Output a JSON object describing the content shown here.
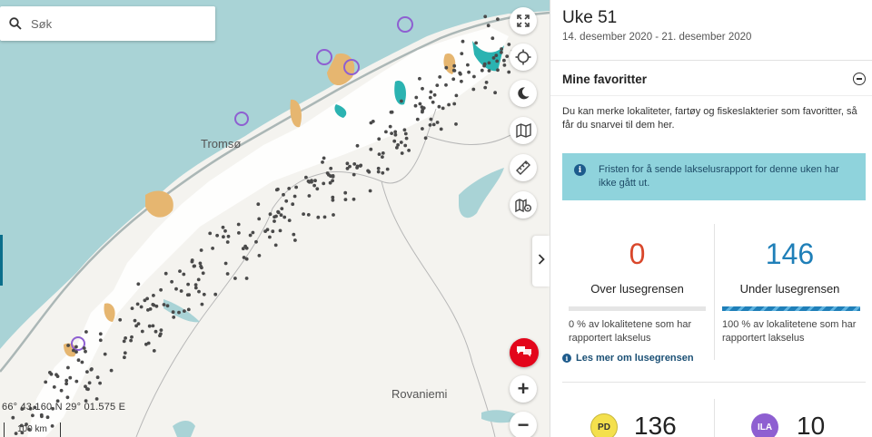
{
  "search": {
    "placeholder": "Søk"
  },
  "map": {
    "labels": {
      "tromso": "Tromsø",
      "rovaniemi": "Rovaniemi"
    },
    "coordinates": "66° 43.160 N 29° 01.575 E",
    "scale": "100 km",
    "controls": {
      "fullscreen": "fullscreen-icon",
      "locate": "crosshair-icon",
      "darkmode": "moon-icon",
      "layers": "map-icon",
      "measure": "ruler-icon",
      "legend": "map-info-icon",
      "collapse": "chevron-right-icon",
      "chat": "chat-icon",
      "zoom_in": "+",
      "zoom_out": "−"
    }
  },
  "panel": {
    "week_title": "Uke 51",
    "week_dates": "14. desember 2020 - 21. desember 2020",
    "favorites": {
      "title": "Mine favoritter",
      "text": "Du kan merke lokaliteter, fartøy og fiskeslakterier som favoritter, så får du snarvei til dem her."
    },
    "info_box": {
      "text": "Fristen for å sende lakselusrapport for denne uken har ikke gått ut."
    },
    "over": {
      "count": "0",
      "label": "Over lusegrensen",
      "desc": "0 % av lokalitetene som har rapportert lakselus",
      "fill": 0,
      "color": "#d9472b"
    },
    "under": {
      "count": "146",
      "label": "Under lusegrensen",
      "desc": "100 % av lokalitetene som har rapportert lakselus",
      "fill": 1,
      "color": "#1f7fb8"
    },
    "read_more": "Les mer om lusegrensen",
    "diseases": {
      "pd": {
        "badge": "PD",
        "count": "136"
      },
      "ila": {
        "badge": "ILA",
        "count": "10"
      }
    }
  }
}
